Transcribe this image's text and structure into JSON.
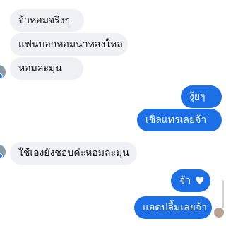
{
  "incoming": [
    {
      "text": "จ้าหอมจริงๆ"
    },
    {
      "text": "แฟนบอกหอมน่าหลงใหล"
    },
    {
      "text": "หอมละมุน"
    },
    {
      "text": "ใช้เองยังชอบค่ะหอมละมุน"
    }
  ],
  "outgoing": [
    {
      "text": "งุ้ยๆ"
    },
    {
      "text": "เชิลแทรเลยจ้า"
    },
    {
      "text": "จ้า"
    },
    {
      "text": "แอดปลื้มเลยจ้า"
    }
  ],
  "icons": {
    "heart": "♥"
  },
  "colors": {
    "outgoing_bubble": "#1d6fe6",
    "incoming_bubble": "#eef0f3"
  }
}
